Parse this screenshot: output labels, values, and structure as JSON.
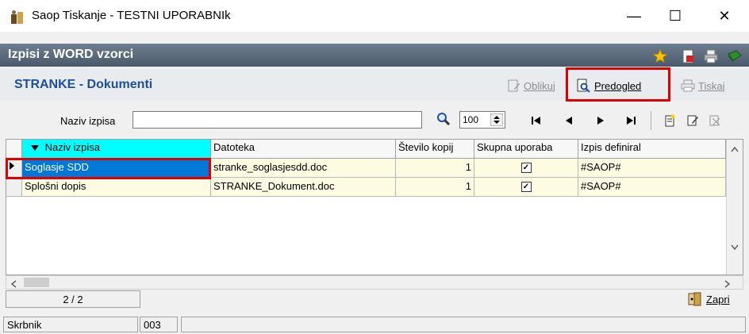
{
  "window": {
    "title": "Saop Tiskanje - TESTNI UPORABNIk",
    "minimize_glyph": "—",
    "maximize_glyph": "☐",
    "close_glyph": "✕"
  },
  "header1": {
    "title": "Izpisi z WORD vzorci",
    "icons": [
      "star-icon",
      "export-icon",
      "printer-icon",
      "book-icon"
    ]
  },
  "header2": {
    "title": "STRANKE - Dokumenti",
    "oblikuj_label": "Oblikuj",
    "predogled_label": "Predogled",
    "tiskaj_label": "Tiskaj"
  },
  "filter": {
    "label": "Naziv izpisa",
    "value": "",
    "zoom_value": "100"
  },
  "grid": {
    "columns": [
      "Naziv izpisa",
      "Datoteka",
      "Število kopij",
      "Skupna uporaba",
      "Izpis definiral"
    ],
    "rows": [
      {
        "naziv": "Soglasje SDD",
        "datoteka": "stranke_soglasjesdd.doc",
        "kopij": "1",
        "skupna": "✓",
        "definiral": "#SAOP#"
      },
      {
        "naziv": "Splošni dopis",
        "datoteka": "STRANKE_Dokument.doc",
        "kopij": "1",
        "skupna": "✓",
        "definiral": "#SAOP#"
      }
    ]
  },
  "footer": {
    "page_indicator": "2 / 2",
    "close_label": "Zapri"
  },
  "statusbar": {
    "label": "Skrbnik",
    "code": "003"
  },
  "colors": {
    "header1_bg": "#5a6a7b",
    "title_blue": "#1c4fa0",
    "selected_row": "#0078d7",
    "row_bg": "#fdfbe1",
    "header_cyan": "#00ffff",
    "highlight_red": "#e00000"
  }
}
